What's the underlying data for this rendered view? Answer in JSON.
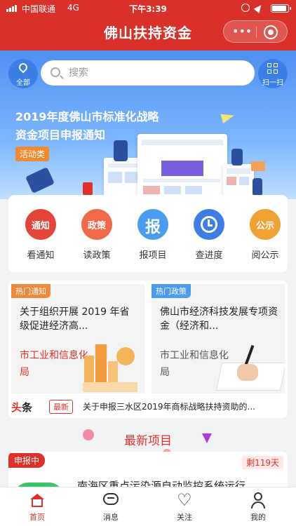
{
  "status_bar": {
    "carrier": "中国联通",
    "network": "4G",
    "time": "下午3:39",
    "battery_level": 0.92
  },
  "header": {
    "title": "佛山扶持资金",
    "menu_icon": "more-dots-icon",
    "close_icon": "target-circle-icon"
  },
  "banner": {
    "location_label": "全部",
    "search_placeholder": "搜索",
    "scan_label": "扫一扫",
    "title": "2019年度佛山市标准化战略资金项目申报通知",
    "tag": "活动类"
  },
  "quick_menu": [
    {
      "icon_text": "通知",
      "label": "看通知",
      "color": "#e5443b"
    },
    {
      "icon_text": "政策",
      "label": "读政策",
      "color": "#ef6a4a"
    },
    {
      "icon_text": "报",
      "label": "报项目",
      "color": "#4a9cf0"
    },
    {
      "icon_text": "",
      "label": "查进度",
      "color": "#3f7de6"
    },
    {
      "icon_text": "公示",
      "label": "阅公示",
      "color": "#f0a234"
    }
  ],
  "hot_cards": [
    {
      "tag": "热门通知",
      "tag_color": "#f0893a",
      "title": "关于组织开展 2019 年省级促进经济高...",
      "subtitle": "市工业和信息化局",
      "subtitle_color": "#e0302a"
    },
    {
      "tag": "热门政策",
      "tag_color": "#4a9cf0",
      "title": "佛山市经济科技发展专项资金（经济和...",
      "subtitle": "市工业和信息化局",
      "subtitle_color": "#555555"
    }
  ],
  "news": {
    "logo_a": "头",
    "logo_b": "条",
    "badge": "最新",
    "text": "关于申报三水区2019年商标战略扶持资助的..."
  },
  "latest": {
    "section_title": "最新项目",
    "project": {
      "status": "申报中",
      "remaining": "剩119天",
      "title": "南海区重点污染源自动监控系统运行"
    }
  },
  "tabbar": [
    {
      "label": "首页",
      "icon": "home-icon",
      "active": true
    },
    {
      "label": "消息",
      "icon": "message-icon",
      "active": false
    },
    {
      "label": "关注",
      "icon": "heart-icon",
      "active": false
    },
    {
      "label": "我的",
      "icon": "user-icon",
      "active": false
    }
  ],
  "colors": {
    "brand": "#d9302a",
    "banner_top": "#4f8ff0",
    "accent_red": "#e0302a"
  }
}
